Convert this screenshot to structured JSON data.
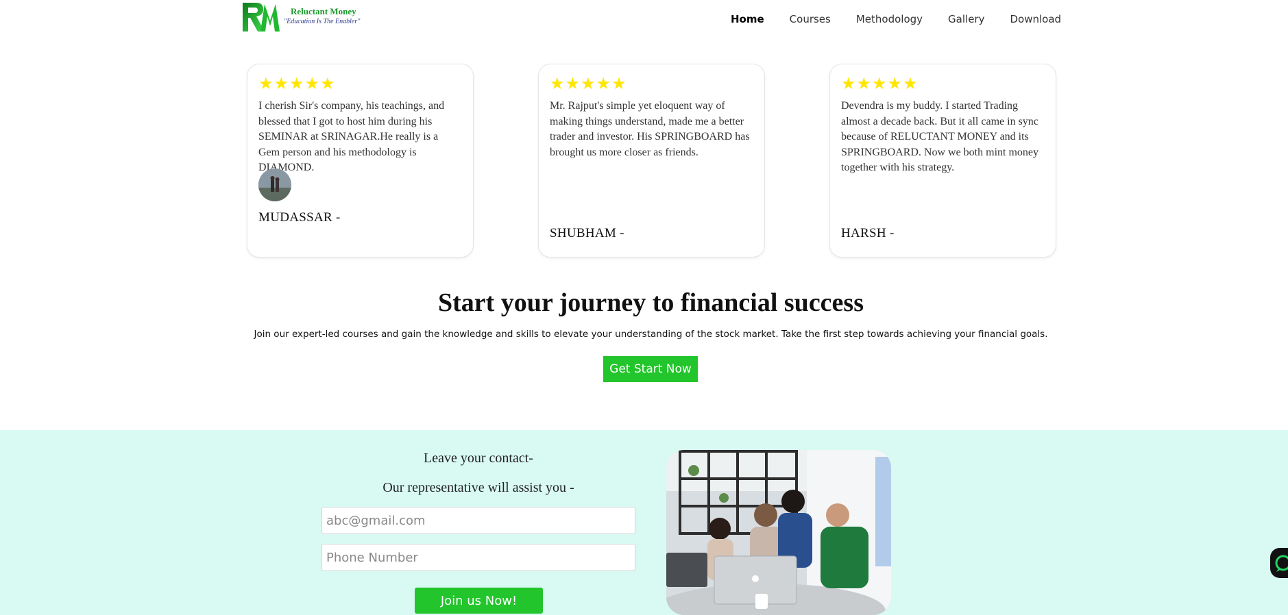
{
  "brand": {
    "name": "Reluctant Money",
    "tagline": "\"Education Is The Enabler\"",
    "colors": {
      "accent": "#22c52b",
      "star": "#ffe600",
      "contact_bg": "#d9faf3"
    }
  },
  "nav": {
    "items": [
      {
        "label": "Home",
        "active": true
      },
      {
        "label": "Courses",
        "active": false
      },
      {
        "label": "Methodology",
        "active": false
      },
      {
        "label": "Gallery",
        "active": false
      },
      {
        "label": "Download",
        "active": false
      }
    ]
  },
  "testimonials": [
    {
      "rating": 5,
      "quote": "I cherish Sir's company, his teachings, and blessed that I got to host him during his SEMINAR at SRINAGAR.He really is a Gem person and his methodology is DIAMOND.",
      "author": "MUDASSAR -",
      "has_avatar": true
    },
    {
      "rating": 5,
      "quote": "Mr. Rajput's simple yet eloquent way of making things understand, made me a better trader and investor. His SPRINGBOARD has brought us more closer as friends.",
      "author": "SHUBHAM -",
      "has_avatar": false
    },
    {
      "rating": 5,
      "quote": "Devendra is my buddy. I started Trading almost a decade back. But it all came in sync because of RELUCTANT MONEY and its SPRINGBOARD. Now we both mint money together with his strategy.",
      "author": "HARSH -",
      "has_avatar": false
    }
  ],
  "cta": {
    "title": "Start your journey to financial success",
    "subtitle": "Join our expert-led courses and gain the knowledge and skills to elevate your understanding of the stock market. Take the first step towards achieving your financial goals.",
    "button": "Get Start Now"
  },
  "contact": {
    "line1": "Leave your contact-",
    "line2": "Our representative will assist you -",
    "email_placeholder": "abc@gmail.com",
    "phone_placeholder": "Phone Number",
    "button": "Join us Now!"
  },
  "icons": {
    "star": "star-icon",
    "chat_fab": "chat-icon"
  }
}
